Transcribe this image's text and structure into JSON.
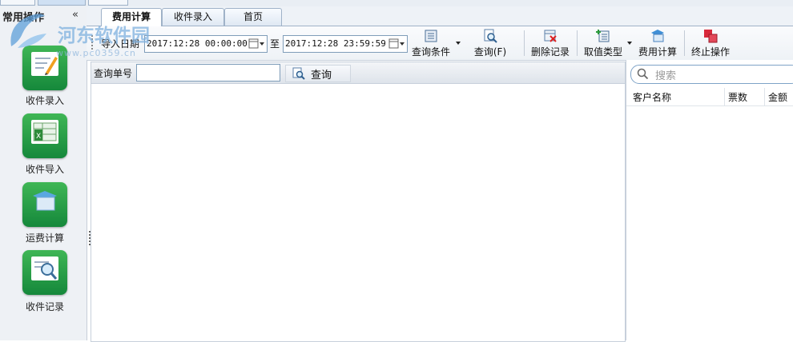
{
  "sidebar": {
    "title": "常用操作",
    "collapse": "«",
    "items": [
      {
        "label": "收件录入",
        "icon": "pen-document-icon"
      },
      {
        "label": "收件导入",
        "icon": "spreadsheet-import-icon"
      },
      {
        "label": "运费计算",
        "icon": "box-icon"
      },
      {
        "label": "收件记录",
        "icon": "magnifier-document-icon"
      }
    ]
  },
  "watermark": {
    "text": "河东软件园",
    "url": "www.pc0359.cn"
  },
  "tabs": [
    {
      "label": "费用计算",
      "active": true
    },
    {
      "label": "收件录入",
      "active": false
    },
    {
      "label": "首页",
      "active": false
    }
  ],
  "toolbar": {
    "import_date_label": "导入日期",
    "date_from": "2017:12:28 00:00:00",
    "to_label": "至",
    "date_to": "2017:12:28 23:59:59",
    "buttons": [
      {
        "label": "查询条件"
      },
      {
        "label": "查询(F)"
      },
      {
        "label": "删除记录"
      },
      {
        "label": "取值类型"
      },
      {
        "label": "费用计算"
      },
      {
        "label": "终止操作"
      }
    ]
  },
  "query": {
    "label": "查询单号",
    "value": "",
    "button_label": "查询"
  },
  "right_panel": {
    "search_placeholder": "搜索",
    "columns": [
      "客户名称",
      "票数",
      "金额"
    ]
  },
  "colors": {
    "accent_green": "#1f9a45",
    "border_blue": "#9fb2c8"
  }
}
